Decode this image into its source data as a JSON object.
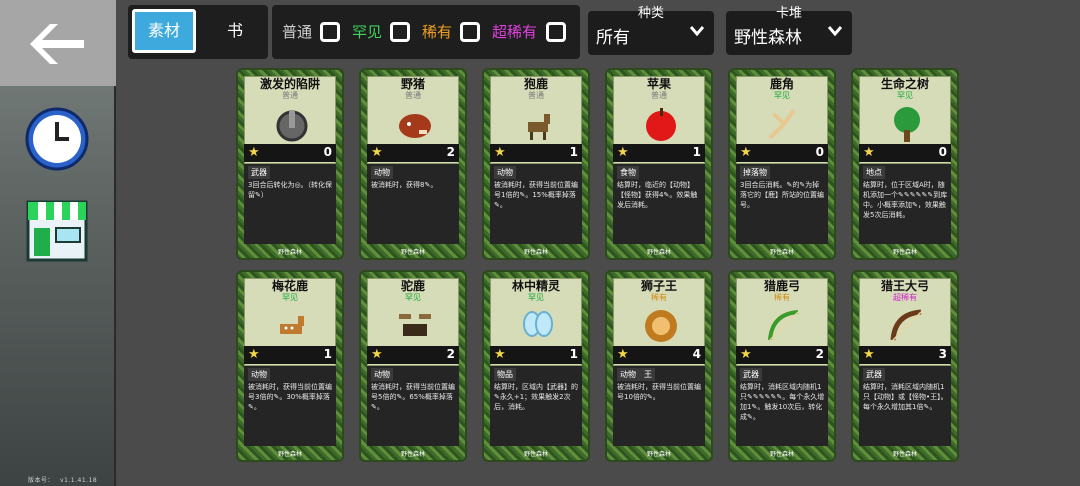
{
  "sidebar": {
    "back_icon": "arrow-left-icon",
    "clock_icon": "clock-icon",
    "shop_icon": "shop-icon",
    "version_label": "版本号：",
    "version_value": "v1.1.41.18"
  },
  "tabs": {
    "active": "素材",
    "other": "书"
  },
  "rarity_filters": [
    {
      "label": "普通",
      "color": "#d0d0d0"
    },
    {
      "label": "罕见",
      "color": "#3fd45a"
    },
    {
      "label": "稀有",
      "color": "#f0a020"
    },
    {
      "label": "超稀有",
      "color": "#e040e0"
    }
  ],
  "dropdowns": {
    "type": {
      "label": "种类",
      "value": "所有"
    },
    "deck": {
      "label": "卡堆",
      "value": "野性森林"
    }
  },
  "colors": {
    "accent": "#3ea9dd",
    "common": "#d0d0d0",
    "uncommon": "#3fd45a",
    "rare": "#f0a020",
    "super_rare": "#e040e0"
  },
  "cards": [
    {
      "title": "激发的陷阱",
      "rarity": "普通",
      "rarity_color": "#7a7a7a",
      "value": "0",
      "type": "武器",
      "desc": "3回合后转化为◎。（转化保留✎）",
      "set": "野性森林",
      "icon": "trap-icon"
    },
    {
      "title": "野猪",
      "rarity": "普通",
      "rarity_color": "#7a7a7a",
      "value": "2",
      "type": "动物",
      "desc": "被消耗时，获得8✎。",
      "set": "野性森林",
      "icon": "boar-icon"
    },
    {
      "title": "狍鹿",
      "rarity": "普通",
      "rarity_color": "#7a7a7a",
      "value": "1",
      "type": "动物",
      "desc": "被消耗时，获得当前位置编号1倍的✎。15%概率掉落✎。",
      "set": "野性森林",
      "icon": "deer-icon"
    },
    {
      "title": "苹果",
      "rarity": "普通",
      "rarity_color": "#7a7a7a",
      "value": "1",
      "type": "食物",
      "desc": "结算时，临近的【动物】【怪物】获得4✎。效果触发后消耗。",
      "set": "野性森林",
      "icon": "apple-icon"
    },
    {
      "title": "鹿角",
      "rarity": "罕见",
      "rarity_color": "#17a83a",
      "value": "0",
      "type": "掉落物",
      "desc": "3回合后消耗。✎的✎为掉落它的【鹿】所站的位置编号。",
      "set": "野性森林",
      "icon": "antler-icon"
    },
    {
      "title": "生命之树",
      "rarity": "罕见",
      "rarity_color": "#17a83a",
      "value": "0",
      "type": "地点",
      "desc": "结算时，位于区域A时，随机添加一个✎✎✎✎✎✎到库中。小概率添加✎，效果触发5次后消耗。",
      "set": "野性森林",
      "icon": "tree-icon"
    },
    {
      "title": "梅花鹿",
      "rarity": "罕见",
      "rarity_color": "#17a83a",
      "value": "1",
      "type": "动物",
      "desc": "被消耗时，获得当前位置编号3倍的✎。30%概率掉落✎。",
      "set": "野性森林",
      "icon": "sika-deer-icon"
    },
    {
      "title": "驼鹿",
      "rarity": "罕见",
      "rarity_color": "#17a83a",
      "value": "2",
      "type": "动物",
      "desc": "被消耗时，获得当前位置编号5倍的✎。65%概率掉落✎。",
      "set": "野性森林",
      "icon": "moose-icon"
    },
    {
      "title": "林中精灵",
      "rarity": "罕见",
      "rarity_color": "#17a83a",
      "value": "1",
      "type": "物品",
      "desc": "结算时，区域内【武器】的✎永久+1；效果触发2次后，消耗。",
      "set": "野性森林",
      "icon": "fairy-icon"
    },
    {
      "title": "狮子王",
      "rarity": "稀有",
      "rarity_color": "#d08a10",
      "value": "4",
      "type": "动物　王",
      "desc": "被消耗时，获得当前位置编号10倍的✎。",
      "set": "野性森林",
      "icon": "lion-icon"
    },
    {
      "title": "猎鹿弓",
      "rarity": "稀有",
      "rarity_color": "#d08a10",
      "value": "2",
      "type": "武器",
      "desc": "结算时，消耗区域内随机1只✎✎✎✎✎✎。每个永久增加1✎。触发10次后，转化成✎。",
      "set": "野性森林",
      "icon": "bow-icon"
    },
    {
      "title": "猎王大弓",
      "rarity": "超稀有",
      "rarity_color": "#d020d0",
      "value": "3",
      "type": "武器",
      "desc": "结算时，消耗区域内随机1只【动物】或【怪物•王】。每个永久增加其1倍✎。",
      "set": "野性森林",
      "icon": "great-bow-icon"
    }
  ]
}
